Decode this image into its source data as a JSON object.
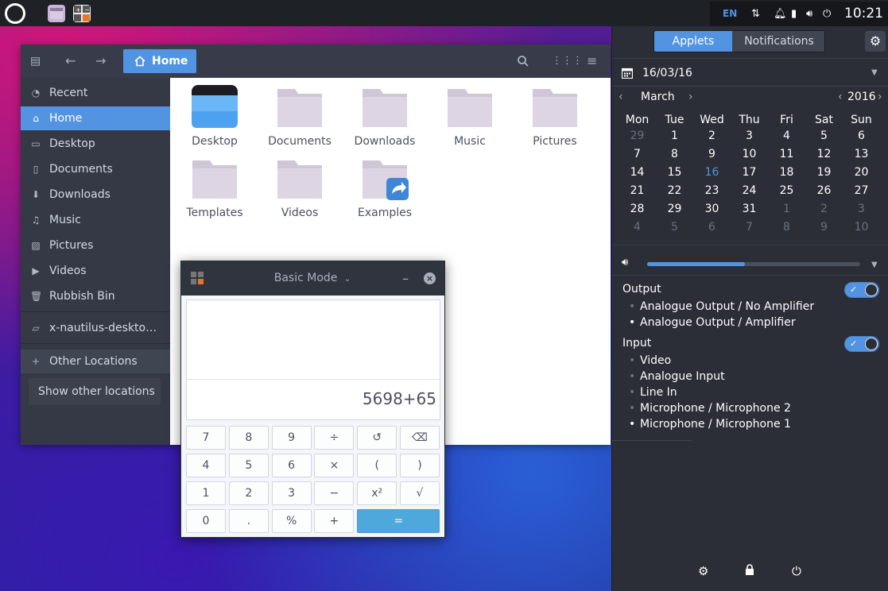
{
  "topbar": {
    "language": "EN",
    "clock": "10:21"
  },
  "file_manager": {
    "path_label": "Home",
    "sidebar": {
      "items": [
        {
          "label": "Recent",
          "icon": "clock-icon"
        },
        {
          "label": "Home",
          "icon": "home-icon",
          "active": true
        },
        {
          "label": "Desktop",
          "icon": "desktop-icon"
        },
        {
          "label": "Documents",
          "icon": "document-icon"
        },
        {
          "label": "Downloads",
          "icon": "download-icon"
        },
        {
          "label": "Music",
          "icon": "music-icon"
        },
        {
          "label": "Pictures",
          "icon": "picture-icon"
        },
        {
          "label": "Videos",
          "icon": "video-icon"
        },
        {
          "label": "Rubbish Bin",
          "icon": "trash-icon"
        },
        {
          "label": "x-nautilus-deskto…",
          "icon": "drive-icon"
        }
      ],
      "other_locations": "Other Locations",
      "show_other_locations": "Show other locations"
    },
    "files": [
      {
        "label": "Desktop",
        "icon": "desktop-folder-icon"
      },
      {
        "label": "Documents",
        "icon": "folder-icon"
      },
      {
        "label": "Downloads",
        "icon": "folder-icon"
      },
      {
        "label": "Music",
        "icon": "folder-icon"
      },
      {
        "label": "Pictures",
        "icon": "folder-icon"
      },
      {
        "label": "Templates",
        "icon": "folder-icon"
      },
      {
        "label": "Videos",
        "icon": "folder-icon"
      },
      {
        "label": "Examples",
        "icon": "shared-folder-icon"
      }
    ]
  },
  "calculator": {
    "mode": "Basic Mode",
    "expression": "5698+65",
    "keys": [
      [
        "7",
        "8",
        "9",
        "÷",
        "↺",
        "⌫"
      ],
      [
        "4",
        "5",
        "6",
        "×",
        "(",
        ")"
      ],
      [
        "1",
        "2",
        "3",
        "−",
        "x²",
        "√"
      ],
      [
        "0",
        ".",
        "%",
        "+",
        "="
      ]
    ]
  },
  "panel": {
    "tabs": [
      "Applets",
      "Notifications"
    ],
    "date": "16/03/16",
    "month": "March",
    "year": "2016",
    "weekdays": [
      "Mon",
      "Tue",
      "Wed",
      "Thu",
      "Fri",
      "Sat",
      "Sun"
    ],
    "weeks": [
      [
        "29",
        "1",
        "2",
        "3",
        "4",
        "5",
        "6"
      ],
      [
        "7",
        "8",
        "9",
        "10",
        "11",
        "12",
        "13"
      ],
      [
        "14",
        "15",
        "16",
        "17",
        "18",
        "19",
        "20"
      ],
      [
        "21",
        "22",
        "23",
        "24",
        "25",
        "26",
        "27"
      ],
      [
        "28",
        "29",
        "30",
        "31",
        "1",
        "2",
        "3"
      ],
      [
        "4",
        "5",
        "6",
        "7",
        "8",
        "9",
        "10"
      ]
    ],
    "today": "16",
    "volume_level": 0.46,
    "output_label": "Output",
    "outputs": [
      "Analogue Output / No Amplifier",
      "Analogue Output / Amplifier"
    ],
    "input_label": "Input",
    "inputs": [
      "Video",
      "Analogue Input",
      "Line In",
      "Microphone / Microphone 2",
      "Microphone / Microphone 1"
    ],
    "accent": "#5294e2"
  }
}
